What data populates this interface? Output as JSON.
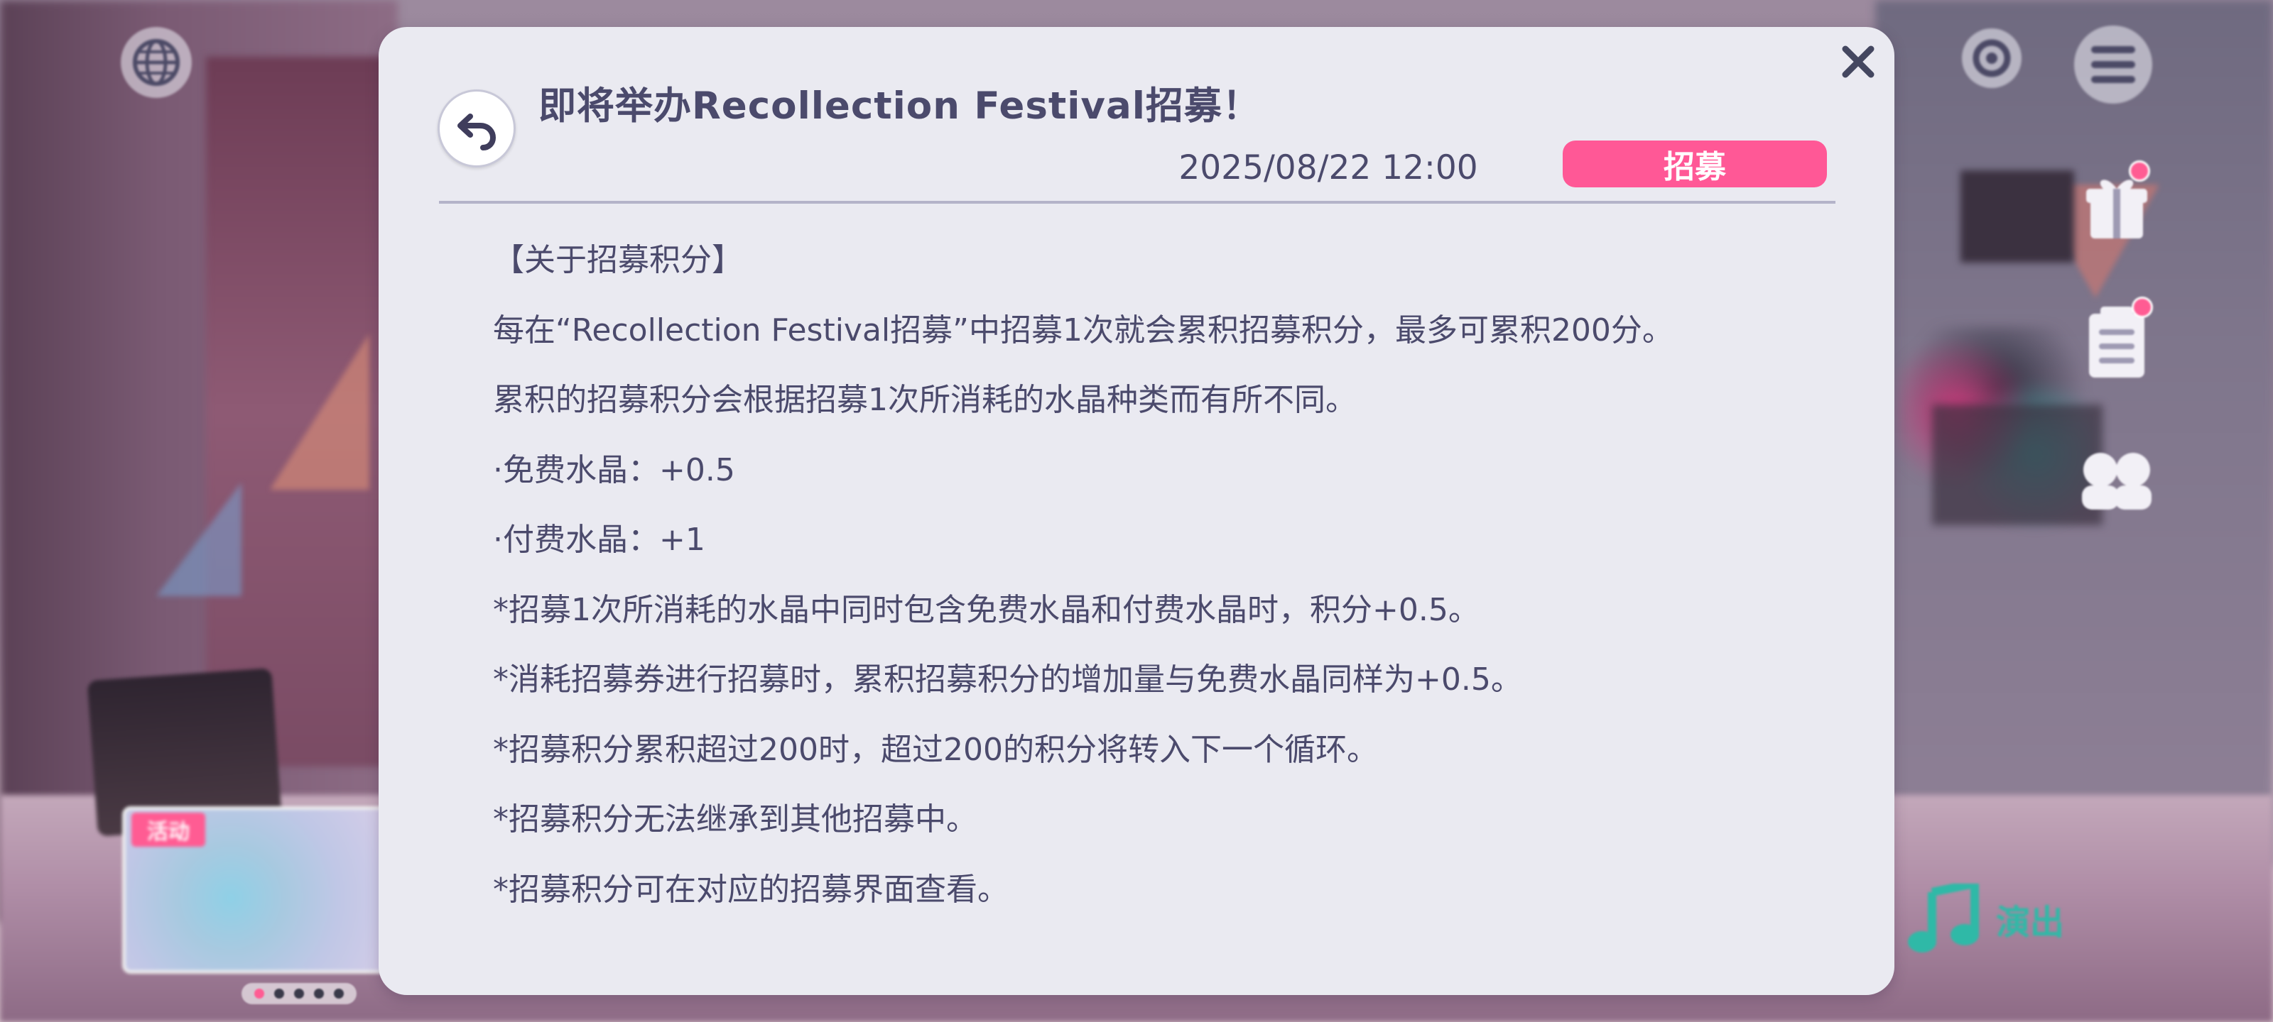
{
  "colors": {
    "accent_pink": "#ff5896",
    "text": "#4b4a6c",
    "modal_bg": "#eaeaf1",
    "performance_green": "#2fb9a7"
  },
  "hud": {
    "globe_icon": "globe-icon",
    "settings_icon": "settings-icon",
    "menu_icon": "hamburger-menu-icon",
    "gift_icon": "gift-icon",
    "list_icon": "notice-list-icon",
    "characters_icon": "characters-icon",
    "performance_label": "演出",
    "event_tag": "活动"
  },
  "notice": {
    "title": "即将举办Recollection Festival招募！",
    "date": "2025/08/22 12:00",
    "category": "招募",
    "back_icon": "back-arrow-icon",
    "close_icon": "close-icon",
    "lines": [
      "【关于招募积分】",
      "每在“Recollection Festival招募”中招募1次就会累积招募积分，最多可累积200分。",
      "累积的招募积分会根据招募1次所消耗的水晶种类而有所不同。",
      "·免费水晶：+0.5",
      "·付费水晶：+1",
      "*招募1次所消耗的水晶中同时包含免费水晶和付费水晶时，积分+0.5。",
      "*消耗招募券进行招募时，累积招募积分的增加量与免费水晶同样为+0.5。",
      "*招募积分累积超过200时，超过200的积分将转入下一个循环。",
      "*招募积分无法继承到其他招募中。",
      "*招募积分可在对应的招募界面查看。"
    ]
  }
}
